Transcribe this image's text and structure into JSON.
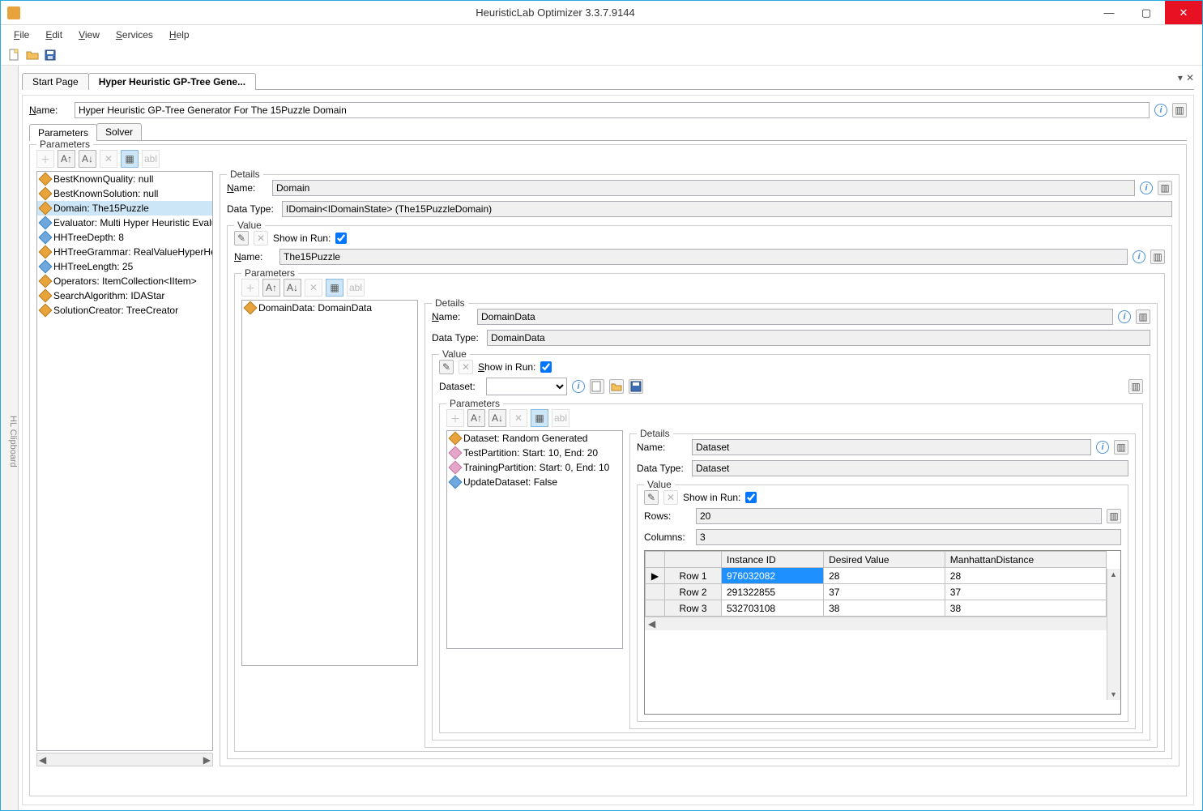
{
  "window": {
    "title": "HeuristicLab Optimizer 3.3.7.9144"
  },
  "menu": {
    "file": "File",
    "edit": "Edit",
    "view": "View",
    "services": "Services",
    "help": "Help"
  },
  "clipboard_tab": "HL Clipboard",
  "doctabs": {
    "start": "Start Page",
    "current": "Hyper Heuristic GP-Tree Gene..."
  },
  "name_label": "Name:",
  "name_value": "Hyper Heuristic GP-Tree Generator For The 15Puzzle Domain",
  "outer_tabs": {
    "parameters": "Parameters",
    "solver": "Solver"
  },
  "parameters_legend": "Parameters",
  "param_tree": [
    "BestKnownQuality: null",
    "BestKnownSolution: null",
    "Domain: The15Puzzle",
    "Evaluator: Multi Hyper Heuristic Evaluator",
    "HHTreeDepth: 8",
    "HHTreeGrammar: RealValueHyperHeuristicGra",
    "HHTreeLength: 25",
    "Operators: ItemCollection<IItem>",
    "SearchAlgorithm: IDAStar",
    "SolutionCreator: TreeCreator"
  ],
  "details_legend": "Details",
  "datatype_label": "Data Type:",
  "domain_details": {
    "name": "Domain",
    "datatype": "IDomain<IDomainState> (The15PuzzleDomain)"
  },
  "value_legend": "Value",
  "show_in_run": "Show in Run:",
  "the15puzzle_name": "The15Puzzle",
  "inner_param_tree": [
    "DomainData: DomainData"
  ],
  "domaindata_details": {
    "name": "DomainData",
    "datatype": "DomainData"
  },
  "dataset_label": "Dataset:",
  "dataset_params": [
    "Dataset: Random Generated",
    "TestPartition: Start: 10, End: 20",
    "TrainingPartition: Start: 0, End: 10",
    "UpdateDataset: False"
  ],
  "dataset_details": {
    "name": "Dataset",
    "datatype": "Dataset"
  },
  "rows_label": "Rows:",
  "rows_value": "20",
  "columns_label": "Columns:",
  "columns_value": "3",
  "table": {
    "headers": [
      "",
      "",
      "Instance ID",
      "Desired Value",
      "ManhattanDistance"
    ],
    "rows": [
      {
        "marker": "▶",
        "hdr": "Row 1",
        "c1": "976032082",
        "c2": "28",
        "c3": "28"
      },
      {
        "marker": "",
        "hdr": "Row 2",
        "c1": "291322855",
        "c2": "37",
        "c3": "37"
      },
      {
        "marker": "",
        "hdr": "Row 3",
        "c1": "532703108",
        "c2": "38",
        "c3": "38"
      }
    ]
  }
}
